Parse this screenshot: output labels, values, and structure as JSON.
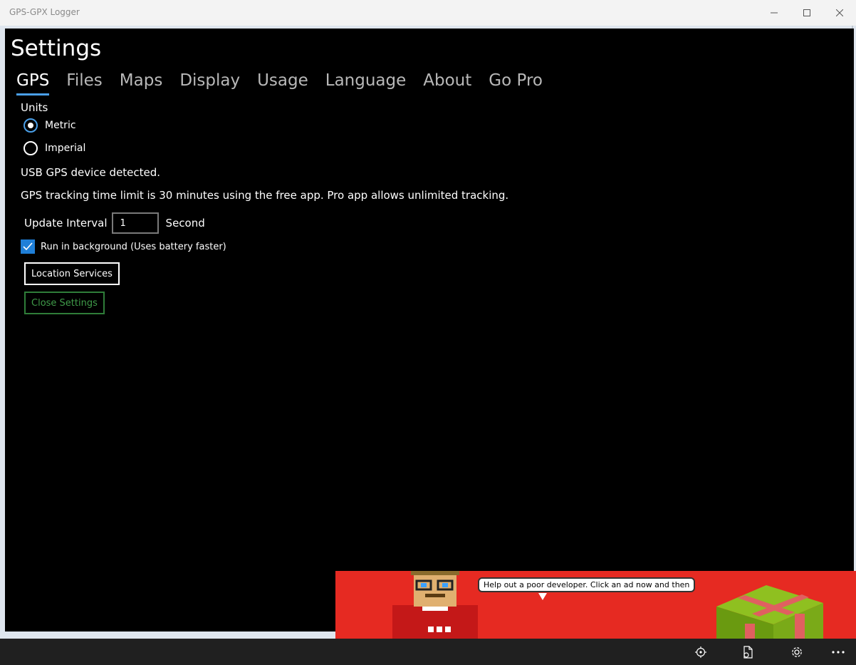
{
  "window": {
    "title": "GPS-GPX Logger"
  },
  "settings": {
    "title": "Settings",
    "tabs": [
      {
        "label": "GPS",
        "active": true
      },
      {
        "label": "Files",
        "active": false
      },
      {
        "label": "Maps",
        "active": false
      },
      {
        "label": "Display",
        "active": false
      },
      {
        "label": "Usage",
        "active": false
      },
      {
        "label": "Language",
        "active": false
      },
      {
        "label": "About",
        "active": false
      },
      {
        "label": "Go Pro",
        "active": false
      }
    ],
    "units": {
      "label": "Units",
      "options": [
        {
          "label": "Metric",
          "checked": true
        },
        {
          "label": "Imperial",
          "checked": false
        }
      ]
    },
    "usb_status": "USB GPS device detected.",
    "time_limit_note": "GPS tracking time limit is 30 minutes using the free app.  Pro app allows unlimited tracking.",
    "update_interval": {
      "label": "Update Interval",
      "value": "1",
      "unit": "Second"
    },
    "background": {
      "label": "Run in background (Uses battery faster)",
      "checked": true
    },
    "location_services_label": "Location Services",
    "close_settings_label": "Close Settings"
  },
  "ad": {
    "speech": "Help out a poor developer.  Click an ad now and then"
  },
  "toolbar": {
    "icons": [
      "locate-icon",
      "file-export-icon",
      "gear-icon",
      "more-icon"
    ]
  },
  "colors": {
    "accent": "#4a9fe8",
    "close_button": "#3f9b49",
    "ad_background": "#e62a22"
  }
}
